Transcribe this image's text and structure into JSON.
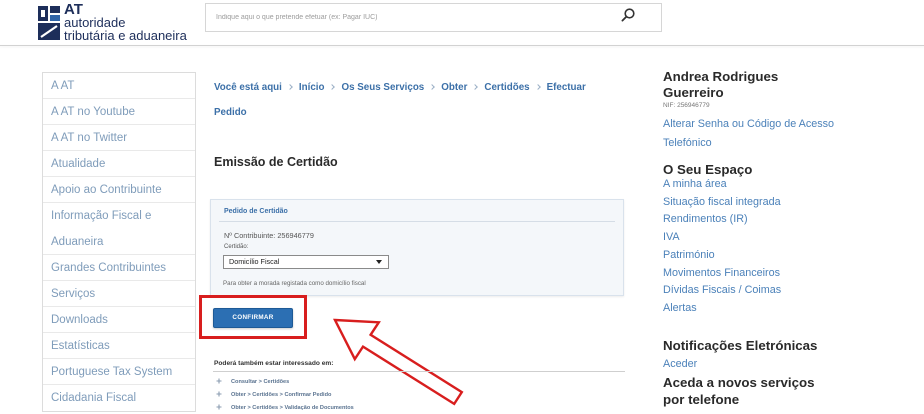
{
  "header": {
    "logo": {
      "line1": "AT",
      "line2": "autoridade",
      "line3": "tributária e aduaneira"
    },
    "search": {
      "placeholder": "Indique aqui o que pretende efetuar (ex: Pagar IUC)",
      "icon": "search-icon"
    }
  },
  "sidebar": {
    "items": [
      "A AT",
      "A AT no Youtube",
      "A AT no Twitter",
      "Atualidade",
      "Apoio ao Contribuinte",
      "Informação Fiscal e Aduaneira",
      "Grandes Contribuintes",
      "Serviços",
      "Downloads",
      "Estatísticas",
      "Portuguese Tax System",
      "Cidadania Fiscal"
    ]
  },
  "breadcrumb": {
    "prefix": "Você está aqui",
    "items": [
      "Início",
      "Os Seus Serviços",
      "Obter",
      "Certidões",
      "Efectuar Pedido"
    ]
  },
  "main": {
    "title": "Emissão de Certidão",
    "form": {
      "heading": "Pedido de Certidão",
      "contribuinte": "Nº Contribuinte: 256946779",
      "certidao_label": "Certidão:",
      "certidao_selected": "Domicílio Fiscal",
      "hint": "Para obter a morada registada como domicílio fiscal",
      "confirm_label": "CONFIRMAR"
    },
    "related": {
      "heading": "Poderá também estar interessado em:",
      "links": [
        "Consultar > Certidões",
        "Obter > Certidões > Confirmar Pedido",
        "Obter > Certidões > Validação de Documentos"
      ]
    }
  },
  "user": {
    "name": "Andrea Rodrigues Guerreiro",
    "nif": "NIF: 256946779",
    "change_access": "Alterar Senha ou Código de Acesso Telefónico"
  },
  "my_space": {
    "heading": "O Seu Espaço",
    "links": [
      "A minha área",
      "Situação fiscal integrada",
      "Rendimentos (IR)",
      "IVA",
      "Património",
      "Movimentos Financeiros",
      "Dívidas Fiscais / Coimas",
      "Alertas"
    ]
  },
  "notifications": {
    "heading": "Notificações Eletrónicas",
    "link": "Aceder"
  },
  "phone_services": {
    "heading": "Aceda a novos serviços por telefone"
  },
  "colors": {
    "brand": "#1d2e5a",
    "accent": "#2c6fb3",
    "link": "#4b81b9",
    "highlight": "#d81e1e"
  }
}
